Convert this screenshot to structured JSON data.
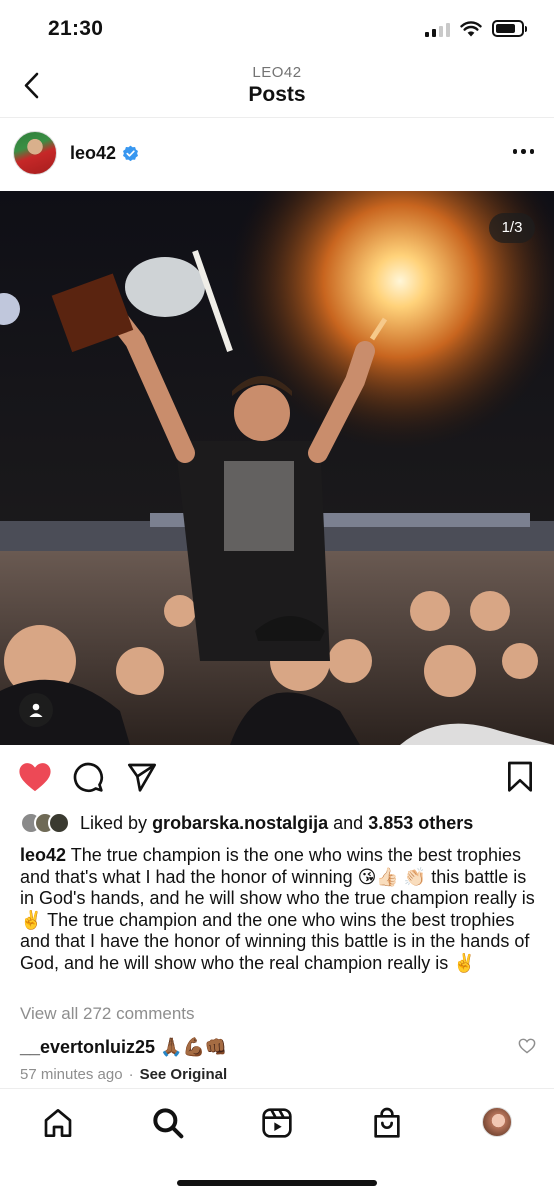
{
  "status_bar": {
    "time": "21:30",
    "icons": [
      "signal-icon",
      "wifi-icon",
      "battery-icon"
    ]
  },
  "header": {
    "subtitle": "LEO42",
    "title": "Posts",
    "back_icon": "chevron-left-icon"
  },
  "post": {
    "username": "leo42",
    "verified": true,
    "more_icon": "more-horizontal-icon",
    "photo": {
      "counter": "1/3",
      "tag_icon": "user-tag-icon"
    },
    "actions": {
      "like": {
        "icon": "heart-icon",
        "liked": true,
        "color": "#ed4956"
      },
      "comment_icon": "comment-icon",
      "share_icon": "send-icon",
      "save_icon": "bookmark-icon"
    },
    "likes": {
      "prefix": "Liked by",
      "first_liker": "grobarska.nostalgija",
      "conjunction": "and",
      "others": "3.853 others"
    },
    "caption": {
      "author": "leo42",
      "text": "The true champion is the one who wins the best trophies and that's what I had the honor of winning 😘👍🏻 👏🏻 this battle is in God's hands, and he will show who the true champion really is ✌️ The true champion and the one who wins the best trophies and that I have the honor of winning this battle is in the hands of God, and he will show who the real champion really is ✌️"
    },
    "view_comments": "View all 272 comments",
    "comment": {
      "username": "__evertonluiz25",
      "text": "🙏🏾💪🏾👊🏾",
      "like_icon": "heart-outline-icon"
    },
    "time_ago": "57 minutes ago",
    "separator": "·",
    "see_original": "See Original"
  },
  "bottom_nav": [
    {
      "name": "home",
      "icon": "home-icon"
    },
    {
      "name": "search",
      "icon": "search-icon"
    },
    {
      "name": "reels",
      "icon": "reels-icon"
    },
    {
      "name": "shop",
      "icon": "shopping-bag-icon"
    },
    {
      "name": "profile",
      "icon": "profile-avatar"
    }
  ],
  "colors": {
    "like_red": "#ed4956",
    "verified_blue": "#3897f0",
    "muted_text": "#8e8e8e"
  }
}
